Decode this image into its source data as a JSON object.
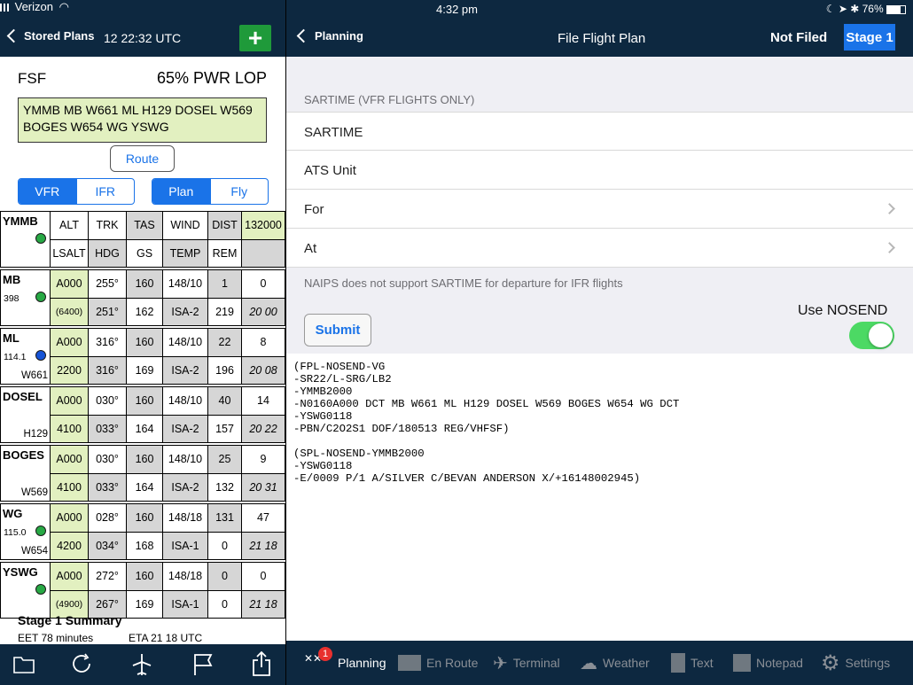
{
  "status": {
    "carrier": "Verizon",
    "time": "4:32 pm",
    "battery": "76%"
  },
  "left_nav": {
    "back_label": "Stored Plans",
    "datetime": "12 22:32 UTC",
    "add_label": "+"
  },
  "plan": {
    "source": "FSF",
    "power": "65% PWR LOP",
    "route": "YMMB MB W661 ML H129 DOSEL W569 BOGES W654 WG YSWG",
    "route_button": "Route",
    "seg1": [
      "VFR",
      "IFR"
    ],
    "seg2": [
      "Plan",
      "Fly"
    ]
  },
  "table": {
    "origin": "YMMB",
    "header1": [
      "ALT",
      "TRK",
      "TAS",
      "WIND",
      "DIST",
      "132000"
    ],
    "header2": [
      "LSALT",
      "HDG",
      "GS",
      "TEMP",
      "REM",
      ""
    ],
    "legs": [
      {
        "wp": "MB",
        "freq": "398",
        "via": "",
        "dot": "#27a844",
        "r1": [
          "A000",
          "255°",
          "160",
          "148/10",
          "1",
          "0"
        ],
        "r2": [
          "(6400)",
          "251°",
          "162",
          "ISA-2",
          "219",
          "20 00"
        ]
      },
      {
        "wp": "ML",
        "freq": "114.1",
        "via": "W661",
        "dot": "#1553d6",
        "r1": [
          "A000",
          "316°",
          "160",
          "148/10",
          "22",
          "8"
        ],
        "r2": [
          "2200",
          "316°",
          "169",
          "ISA-2",
          "196",
          "20 08"
        ]
      },
      {
        "wp": "DOSEL",
        "freq": "",
        "via": "H129",
        "dot": "",
        "r1": [
          "A000",
          "030°",
          "160",
          "148/10",
          "40",
          "14"
        ],
        "r2": [
          "4100",
          "033°",
          "164",
          "ISA-2",
          "157",
          "20 22"
        ]
      },
      {
        "wp": "BOGES",
        "freq": "",
        "via": "W569",
        "dot": "",
        "r1": [
          "A000",
          "030°",
          "160",
          "148/10",
          "25",
          "9"
        ],
        "r2": [
          "4100",
          "033°",
          "164",
          "ISA-2",
          "132",
          "20 31"
        ]
      },
      {
        "wp": "WG",
        "freq": "115.0",
        "via": "W654",
        "dot": "#27a844",
        "r1": [
          "A000",
          "028°",
          "160",
          "148/18",
          "131",
          "47"
        ],
        "r2": [
          "4200",
          "034°",
          "168",
          "ISA-1",
          "0",
          "21 18"
        ]
      },
      {
        "wp": "YSWG",
        "freq": "",
        "via": "",
        "dot": "#27a844",
        "r1": [
          "A000",
          "272°",
          "160",
          "148/18",
          "0",
          "0"
        ],
        "r2": [
          "(4900)",
          "267°",
          "169",
          "ISA-1",
          "0",
          "21 18"
        ]
      }
    ]
  },
  "summary": {
    "title": "Stage 1 Summary",
    "eet": "EET 78 minutes",
    "eta": "ETA 21 18 UTC"
  },
  "right_nav": {
    "back_label": "Planning",
    "title": "File Flight Plan",
    "status": "Not Filed",
    "stage": "Stage 1"
  },
  "form": {
    "section_header": "SARTIME (VFR FLIGHTS ONLY)",
    "rows": [
      "SARTIME",
      "ATS Unit",
      "For",
      "At"
    ],
    "note": "NAIPS does not support SARTIME for departure for IFR flights",
    "submit": "Submit",
    "nosend_label": "Use NOSEND",
    "nosend_on": true
  },
  "flight_plan_text": "(FPL-NOSEND-VG\n-SR22/L-SRG/LB2\n-YMMB2000\n-N0160A000 DCT MB W661 ML H129 DOSEL W569 BOGES W654 WG DCT\n-YSWG0118\n-PBN/C2O2S1 DOF/180513 REG/VHFSF)\n\n(SPL-NOSEND-YMMB2000\n-YSWG0118\n-E/0009 P/1 A/SILVER C/BEVAN ANDERSON X/+16148002945)",
  "tabs": [
    {
      "label": "Planning",
      "icon": "planning-icon",
      "badge": "1",
      "active": true
    },
    {
      "label": "En Route",
      "icon": "map-icon"
    },
    {
      "label": "Terminal",
      "icon": "airplane-icon"
    },
    {
      "label": "Weather",
      "icon": "cloud-icon"
    },
    {
      "label": "Text",
      "icon": "document-icon"
    },
    {
      "label": "Notepad",
      "icon": "notepad-icon"
    },
    {
      "label": "Settings",
      "icon": "gear-icon"
    }
  ],
  "colors": {
    "navy": "#0d2840",
    "accent": "#1a73e8",
    "add_green": "#1f9a3a",
    "toggle_green": "#4cd964",
    "route_bg": "#e2f0c0"
  }
}
